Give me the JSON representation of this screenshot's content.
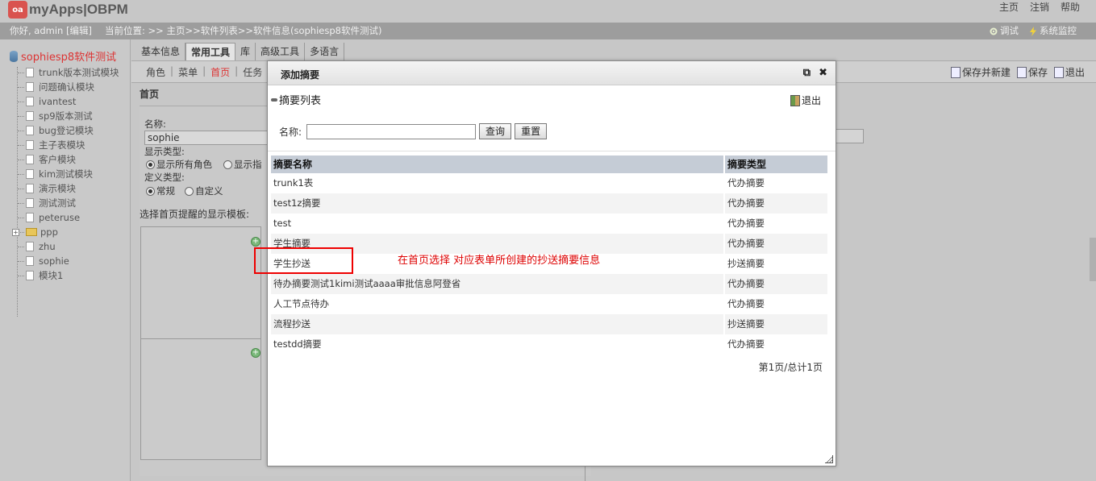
{
  "app": {
    "logo_badge": "oa",
    "logo_text": "myApps|OBPM"
  },
  "topnav": {
    "home": "主页",
    "logout": "注销",
    "help": "帮助"
  },
  "status": {
    "greeting": "你好, admin [编辑]",
    "location": "当前位置: >> 主页>>软件列表>>软件信息(sophiesp8软件测试)",
    "debug": "调试",
    "monitor": "系统监控"
  },
  "sidebar": {
    "root": "sophiesp8软件测试",
    "items": [
      {
        "label": "trunk版本测试模块",
        "type": "doc"
      },
      {
        "label": "问题确认模块",
        "type": "doc"
      },
      {
        "label": "ivantest",
        "type": "doc"
      },
      {
        "label": "sp9版本测试",
        "type": "doc"
      },
      {
        "label": "bug登记模块",
        "type": "doc"
      },
      {
        "label": "主子表模块",
        "type": "doc"
      },
      {
        "label": "客户模块",
        "type": "doc"
      },
      {
        "label": "kim测试模块",
        "type": "doc"
      },
      {
        "label": "演示模块",
        "type": "doc"
      },
      {
        "label": "测试测试",
        "type": "doc"
      },
      {
        "label": "peteruse",
        "type": "doc"
      },
      {
        "label": "ppp",
        "type": "folder"
      },
      {
        "label": "zhu",
        "type": "doc"
      },
      {
        "label": "sophie",
        "type": "doc"
      },
      {
        "label": "模块1",
        "type": "doc"
      }
    ]
  },
  "tabs": [
    "基本信息",
    "常用工具",
    "库",
    "高级工具",
    "多语言"
  ],
  "subnav": {
    "role": "角色",
    "menu": "菜单",
    "home": "首页",
    "task": "任务"
  },
  "actions": {
    "save_new": "保存并新建",
    "save": "保存",
    "exit": "退出"
  },
  "form": {
    "section_title": "首页",
    "name_label": "名称:",
    "name_value": "sophie",
    "display_type_label": "显示类型:",
    "display_all": "显示所有角色",
    "display_specified": "显示指",
    "define_type_label": "定义类型:",
    "define_normal": "常规",
    "define_custom": "自定义",
    "template_label": "选择首页提醒的显示模板:"
  },
  "modal": {
    "title": "添加摘要",
    "restore_icon": "⧉",
    "close_icon": "✖",
    "list_title": "摘要列表",
    "exit": "退出",
    "search_label": "名称:",
    "search_value": "",
    "query_btn": "查询",
    "reset_btn": "重置",
    "columns": [
      "摘要名称",
      "摘要类型"
    ],
    "rows": [
      [
        "trunk1表",
        "代办摘要"
      ],
      [
        "test1z摘要",
        "代办摘要"
      ],
      [
        "test",
        "代办摘要"
      ],
      [
        "学生摘要",
        "代办摘要"
      ],
      [
        "学生抄送",
        "抄送摘要"
      ],
      [
        "待办摘要测试1kimi测试aaaa审批信息阿登省",
        "代办摘要"
      ],
      [
        "人工节点待办",
        "代办摘要"
      ],
      [
        "流程抄送",
        "抄送摘要"
      ],
      [
        "testdd摘要",
        "代办摘要"
      ]
    ],
    "pager": "第1页/总计1页"
  },
  "annotation": "在首页选择  对应表单所创建的抄送摘要信息"
}
